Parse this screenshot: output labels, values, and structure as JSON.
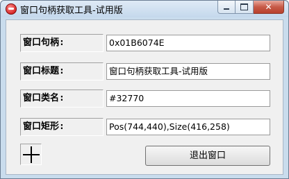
{
  "window": {
    "title": "窗口句柄获取工具-试用版",
    "close_glyph": "✕"
  },
  "fields": [
    {
      "label": "窗口句柄:",
      "value": "0x01B6074E"
    },
    {
      "label": "窗口标题:",
      "value": "窗口句柄获取工具-试用版"
    },
    {
      "label": "窗口类名:",
      "value": "#32770"
    },
    {
      "label": "窗口矩形:",
      "value": "Pos(744,440),Size(416,258)"
    }
  ],
  "actions": {
    "exit_label": "退出窗口"
  },
  "icons": {
    "app": "app-icon",
    "finder": "crosshair-icon"
  }
}
